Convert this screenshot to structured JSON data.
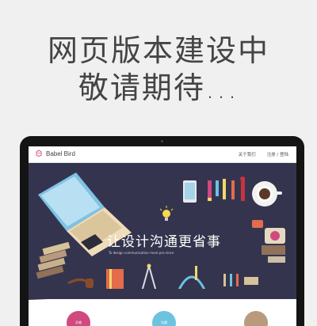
{
  "announcement": {
    "line1": "网页版本建设中",
    "line2": "敬请期待..."
  },
  "site": {
    "brand": "Babel Bird",
    "nav": [
      "关于我们",
      "注册 / 登陆"
    ],
    "hero_title": "让设计沟通更省事",
    "hero_subtitle": "To design communication more pro-since",
    "circles": [
      {
        "label": "灵感",
        "color": "#d0497f"
      },
      {
        "label": "沟通",
        "color": "#6cc3e0"
      },
      {
        "label": "",
        "color": "#b99a7c"
      }
    ]
  },
  "colors": {
    "page_bg": "#f0f0f0",
    "hero_bg": "#35344e",
    "laptop_bezel": "#141414",
    "brand_accent": "#d2517a"
  },
  "icons": [
    "babel-bird-logo-icon",
    "laptop-illustration",
    "tablet-illustration",
    "pencil-illustration",
    "coffee-cup-illustration",
    "lightbulb-illustration",
    "book-stack-illustration",
    "compass-illustration",
    "headphones-illustration",
    "pipe-illustration",
    "notebook-illustration"
  ]
}
